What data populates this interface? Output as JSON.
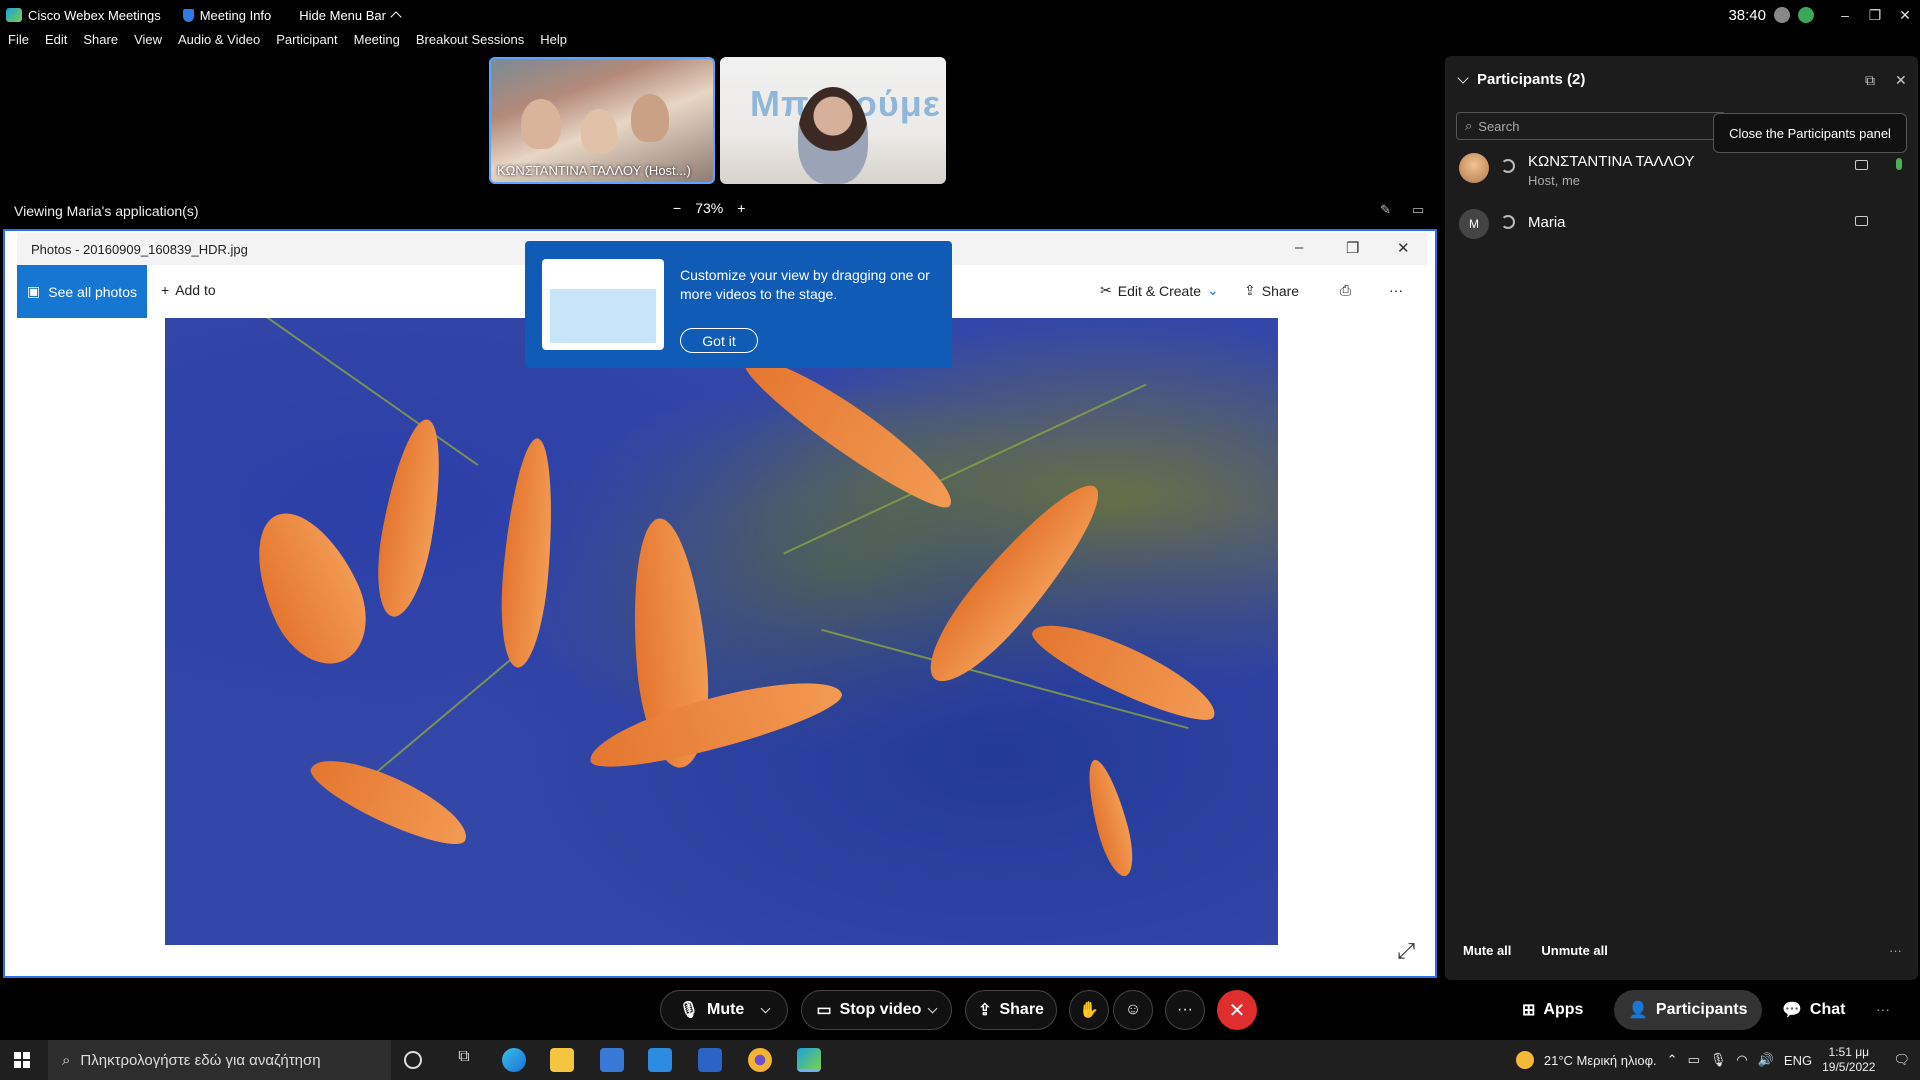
{
  "titlebar": {
    "app_name": "Cisco Webex Meetings",
    "meeting_info": "Meeting Info",
    "hide_menu": "Hide Menu Bar",
    "timer": "38:40"
  },
  "menu": [
    "File",
    "Edit",
    "Share",
    "View",
    "Audio & Video",
    "Participant",
    "Meeting",
    "Breakout Sessions",
    "Help"
  ],
  "thumbnails": {
    "host_label": "ΚΩΝΣΤΑΝΤΙΝΑ ΤΑΛΛΟΥ (Host...)",
    "second_text": "Μπορούμε"
  },
  "viewing": {
    "text": "Viewing Maria's application(s)",
    "zoom": "73%",
    "minus": "−",
    "plus": "+"
  },
  "photos": {
    "title": "Photos - 20160909_160839_HDR.jpg",
    "see_all": "See all photos",
    "add_to": "Add to",
    "edit_create": "Edit & Create",
    "share": "Share",
    "more": "···"
  },
  "tip": {
    "text": "Customize your view by dragging one or more videos to the stage.",
    "button": "Got it"
  },
  "panel": {
    "title": "Participants (2)",
    "search_placeholder": "Search",
    "close_tooltip": "Close the Participants panel",
    "participants": [
      {
        "name": "ΚΩΝΣΤΑΝΤΙΝΑ ΤΑΛΛΟΥ",
        "sub": "Host, me",
        "initial": ""
      },
      {
        "name": "Maria",
        "sub": "",
        "initial": "M"
      }
    ],
    "mute_all": "Mute all",
    "unmute_all": "Unmute all",
    "more": "···"
  },
  "controls": {
    "mute": "Mute",
    "stop_video": "Stop video",
    "share": "Share",
    "more": "···",
    "apps": "Apps",
    "participants": "Participants",
    "chat": "Chat",
    "overflow": "···"
  },
  "taskbar": {
    "search_placeholder": "Πληκτρολογήστε εδώ για αναζήτηση",
    "weather": "21°C  Μερική ηλιοφ.",
    "lang": "ENG",
    "time": "1:51 μμ",
    "date": "19/5/2022"
  },
  "colors": {
    "accent": "#2b6fe6",
    "tip_bg": "#0f5bb5",
    "leave": "#e02e2e",
    "see_all": "#1677d2"
  }
}
